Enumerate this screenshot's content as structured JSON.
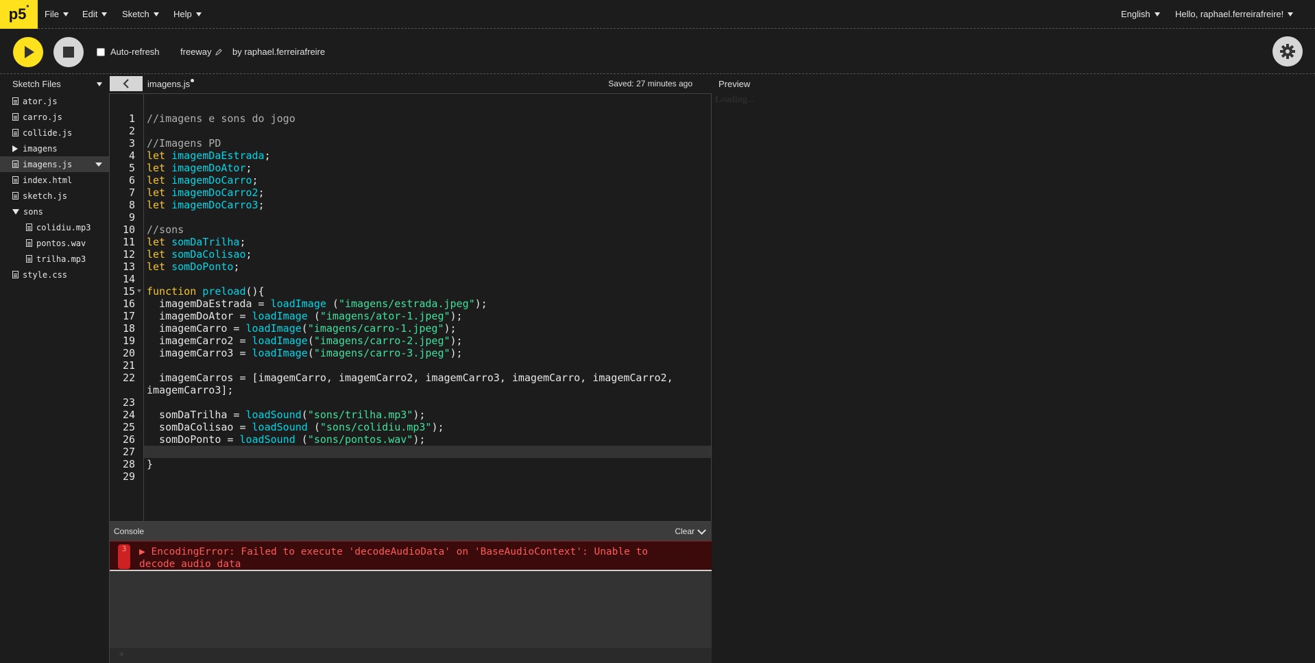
{
  "nav": {
    "logo": "p5",
    "logo_mark": "*",
    "menus": [
      "File",
      "Edit",
      "Sketch",
      "Help"
    ],
    "language": "English",
    "greeting": "Hello, raphael.ferreirafreire!"
  },
  "toolbar": {
    "auto_refresh_label": "Auto-refresh",
    "auto_refresh_checked": false,
    "sketch_name": "freeway",
    "byline": "by raphael.ferreirafreire"
  },
  "sidebar": {
    "title": "Sketch Files",
    "items": [
      {
        "label": "ator.js",
        "type": "file",
        "level": 0
      },
      {
        "label": "carro.js",
        "type": "file",
        "level": 0
      },
      {
        "label": "collide.js",
        "type": "file",
        "level": 0
      },
      {
        "label": "imagens",
        "type": "folder-closed",
        "level": 0
      },
      {
        "label": "imagens.js",
        "type": "file",
        "level": 0,
        "selected": true
      },
      {
        "label": "index.html",
        "type": "file",
        "level": 0
      },
      {
        "label": "sketch.js",
        "type": "file",
        "level": 0
      },
      {
        "label": "sons",
        "type": "folder-open",
        "level": 0
      },
      {
        "label": "colidiu.mp3",
        "type": "file",
        "level": 1
      },
      {
        "label": "pontos.wav",
        "type": "file",
        "level": 1
      },
      {
        "label": "trilha.mp3",
        "type": "file",
        "level": 1
      },
      {
        "label": "style.css",
        "type": "file",
        "level": 0
      }
    ]
  },
  "editor": {
    "tab_filename": "imagens.js",
    "saved_status": "Saved: 27 minutes ago",
    "active_line": 27,
    "lines": [
      {
        "n": "1",
        "tokens": [
          [
            "cm",
            "//imagens e sons do jogo"
          ]
        ]
      },
      {
        "n": "2",
        "tokens": []
      },
      {
        "n": "3",
        "tokens": [
          [
            "cm",
            "//Imagens PD"
          ]
        ]
      },
      {
        "n": "4",
        "tokens": [
          [
            "kw",
            "let "
          ],
          [
            "var",
            "imagemDaEstrada"
          ],
          [
            "plain",
            ";"
          ]
        ]
      },
      {
        "n": "5",
        "tokens": [
          [
            "kw",
            "let "
          ],
          [
            "var",
            "imagemDoAtor"
          ],
          [
            "plain",
            ";"
          ]
        ]
      },
      {
        "n": "6",
        "tokens": [
          [
            "kw",
            "let "
          ],
          [
            "var",
            "imagemDoCarro"
          ],
          [
            "plain",
            ";"
          ]
        ]
      },
      {
        "n": "7",
        "tokens": [
          [
            "kw",
            "let "
          ],
          [
            "var",
            "imagemDoCarro2"
          ],
          [
            "plain",
            ";"
          ]
        ]
      },
      {
        "n": "8",
        "tokens": [
          [
            "kw",
            "let "
          ],
          [
            "var",
            "imagemDoCarro3"
          ],
          [
            "plain",
            ";"
          ]
        ]
      },
      {
        "n": "9",
        "tokens": []
      },
      {
        "n": "10",
        "tokens": [
          [
            "cm",
            "//sons"
          ]
        ]
      },
      {
        "n": "11",
        "tokens": [
          [
            "kw",
            "let "
          ],
          [
            "var",
            "somDaTrilha"
          ],
          [
            "plain",
            ";"
          ]
        ]
      },
      {
        "n": "12",
        "tokens": [
          [
            "kw",
            "let "
          ],
          [
            "var",
            "somDaColisao"
          ],
          [
            "plain",
            ";"
          ]
        ]
      },
      {
        "n": "13",
        "tokens": [
          [
            "kw",
            "let "
          ],
          [
            "var",
            "somDoPonto"
          ],
          [
            "plain",
            ";"
          ]
        ]
      },
      {
        "n": "14",
        "tokens": []
      },
      {
        "n": "15",
        "fold": true,
        "tokens": [
          [
            "kw",
            "function "
          ],
          [
            "fn",
            "preload"
          ],
          [
            "plain",
            "(){"
          ]
        ]
      },
      {
        "n": "16",
        "tokens": [
          [
            "plain",
            "  imagemDaEstrada = "
          ],
          [
            "fn",
            "loadImage"
          ],
          [
            "plain",
            " ("
          ],
          [
            "str",
            "\"imagens/estrada.jpeg\""
          ],
          [
            "plain",
            ");"
          ]
        ]
      },
      {
        "n": "17",
        "tokens": [
          [
            "plain",
            "  imagemDoAtor = "
          ],
          [
            "fn",
            "loadImage"
          ],
          [
            "plain",
            " ("
          ],
          [
            "str",
            "\"imagens/ator-1.jpeg\""
          ],
          [
            "plain",
            ");"
          ]
        ]
      },
      {
        "n": "18",
        "tokens": [
          [
            "plain",
            "  imagemCarro = "
          ],
          [
            "fn",
            "loadImage"
          ],
          [
            "plain",
            "("
          ],
          [
            "str",
            "\"imagens/carro-1.jpeg\""
          ],
          [
            "plain",
            ");"
          ]
        ]
      },
      {
        "n": "19",
        "tokens": [
          [
            "plain",
            "  imagemCarro2 = "
          ],
          [
            "fn",
            "loadImage"
          ],
          [
            "plain",
            "("
          ],
          [
            "str",
            "\"imagens/carro-2.jpeg\""
          ],
          [
            "plain",
            ");"
          ]
        ]
      },
      {
        "n": "20",
        "tokens": [
          [
            "plain",
            "  imagemCarro3 = "
          ],
          [
            "fn",
            "loadImage"
          ],
          [
            "plain",
            "("
          ],
          [
            "str",
            "\"imagens/carro-3.jpeg\""
          ],
          [
            "plain",
            ");"
          ]
        ]
      },
      {
        "n": "21",
        "tokens": []
      },
      {
        "n": "22",
        "tokens": [
          [
            "plain",
            "  imagemCarros = [imagemCarro, imagemCarro2, imagemCarro3, imagemCarro, imagemCarro2,"
          ]
        ]
      },
      {
        "n": "",
        "tokens": [
          [
            "plain",
            "imagemCarro3];"
          ]
        ]
      },
      {
        "n": "23",
        "tokens": []
      },
      {
        "n": "24",
        "tokens": [
          [
            "plain",
            "  somDaTrilha = "
          ],
          [
            "fn",
            "loadSound"
          ],
          [
            "plain",
            "("
          ],
          [
            "str",
            "\"sons/trilha.mp3\""
          ],
          [
            "plain",
            ");"
          ]
        ]
      },
      {
        "n": "25",
        "tokens": [
          [
            "plain",
            "  somDaColisao = "
          ],
          [
            "fn",
            "loadSound"
          ],
          [
            "plain",
            " ("
          ],
          [
            "str",
            "\"sons/colidiu.mp3\""
          ],
          [
            "plain",
            ");"
          ]
        ]
      },
      {
        "n": "26",
        "tokens": [
          [
            "plain",
            "  somDoPonto = "
          ],
          [
            "fn",
            "loadSound"
          ],
          [
            "plain",
            " ("
          ],
          [
            "str",
            "\"sons/pontos.wav\""
          ],
          [
            "plain",
            ");"
          ]
        ]
      },
      {
        "n": "27",
        "tokens": []
      },
      {
        "n": "28",
        "tokens": [
          [
            "plain",
            "}"
          ]
        ]
      },
      {
        "n": "29",
        "tokens": []
      }
    ]
  },
  "preview": {
    "label": "Preview",
    "loading": "Loading..."
  },
  "console": {
    "title": "Console",
    "clear_label": "Clear",
    "error_count": "3",
    "error_message": "▶ EncodingError: Failed to execute 'decodeAudioData' on 'BaseAudioContext': Unable to decode audio data",
    "prompt": ">"
  },
  "colors": {
    "accent": "#ffe21d",
    "keyword": "#f4c430",
    "identifier": "#00d6e6",
    "string": "#40e0a0",
    "error": "#ff5a5a"
  }
}
